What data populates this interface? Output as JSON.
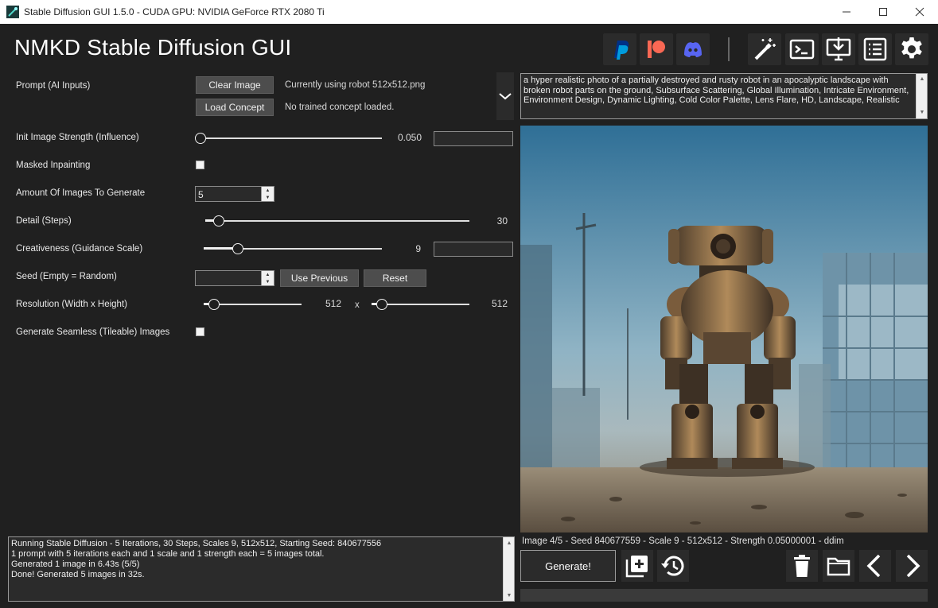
{
  "window": {
    "title": "Stable Diffusion GUI 1.5.0 - CUDA GPU: NVIDIA GeForce RTX 2080 Ti"
  },
  "header": {
    "app_title": "NMKD Stable Diffusion GUI",
    "icons": [
      "paypal-icon",
      "patreon-icon",
      "discord-icon",
      "wand-icon",
      "terminal-icon",
      "install-icon",
      "list-icon",
      "settings-icon"
    ]
  },
  "prompt": {
    "label": "Prompt (AI Inputs)",
    "clear_image_label": "Clear Image",
    "load_concept_label": "Load Concept",
    "init_image_info": "Currently using robot 512x512.png",
    "concept_info": "No trained concept loaded.",
    "text": "a hyper realistic photo of a partially destroyed and rusty robot in an apocalyptic landscape with broken robot parts on the ground, Subsurface Scattering, Global Illumination, Intricate Environment, Environment Design, Dynamic Lighting, Cold Color Palette, Lens Flare, HD, Landscape, Realistic"
  },
  "settings": {
    "init_strength": {
      "label": "Init Image Strength (Influence)",
      "value": "0.050",
      "level": 0.0
    },
    "masked_inpainting": {
      "label": "Masked Inpainting",
      "checked": false
    },
    "images_to_generate": {
      "label": "Amount Of Images To Generate",
      "value": "5"
    },
    "steps": {
      "label": "Detail (Steps)",
      "value": "30",
      "level": 0.03
    },
    "guidance": {
      "label": "Creativeness (Guidance Scale)",
      "value": "9",
      "level": 0.16
    },
    "seed": {
      "label": "Seed (Empty = Random)",
      "value": "",
      "use_previous_label": "Use Previous",
      "reset_label": "Reset"
    },
    "resolution": {
      "label": "Resolution (Width x Height)",
      "width": "512",
      "height": "512",
      "separator": "x",
      "width_level": 0.05,
      "height_level": 0.05
    },
    "seamless": {
      "label": "Generate Seamless (Tileable) Images",
      "checked": false
    }
  },
  "log": {
    "lines": [
      "Running Stable Diffusion - 5 Iterations, 30 Steps, Scales 9, 512x512, Starting Seed: 840677556",
      "1 prompt with 5 iterations each and 1 scale and 1 strength each = 5 images total.",
      "Generated 1 image in 6.43s (5/5)",
      "Done! Generated 5 images in 32s."
    ]
  },
  "image_panel": {
    "status": "Image 4/5  - Seed 840677559 - Scale 9 - 512x512 - Strength 0.05000001 - ddim"
  },
  "actions": {
    "generate_label": "Generate!",
    "icons": [
      "add-queue-icon",
      "history-icon",
      "delete-icon",
      "folder-icon",
      "previous-icon",
      "next-icon"
    ]
  },
  "colors": {
    "background": "#202020",
    "panel": "#2b2b2b",
    "button": "#4d4d4d",
    "paypal": "#003087",
    "patreon": "#f96854",
    "discord": "#5865f2"
  }
}
